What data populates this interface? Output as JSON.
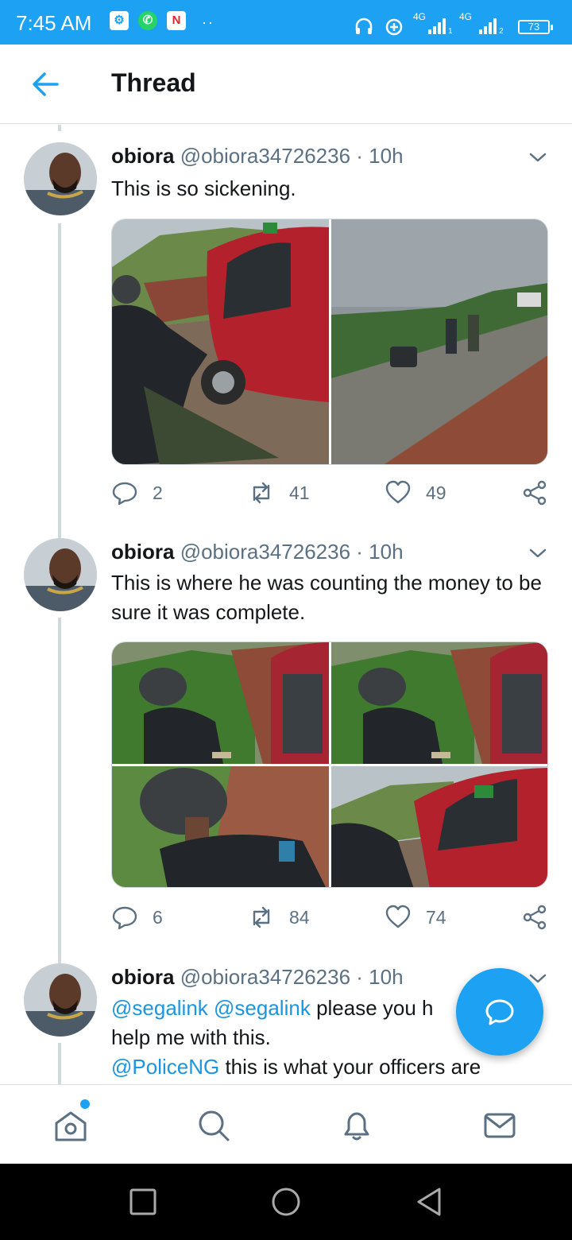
{
  "status_bar": {
    "time": "7:45 AM",
    "app_icons": [
      "settings-icon",
      "whatsapp-icon",
      "news-icon"
    ],
    "dots": "··",
    "network_1": "4G",
    "network_2": "4G",
    "sim_1": "1",
    "sim_2": "2",
    "battery": "73"
  },
  "header": {
    "back_icon": "arrow-left-icon",
    "title": "Thread"
  },
  "tweets": [
    {
      "name": "obiora",
      "handle": "@obiora34726236",
      "time": "· 10h",
      "text": "This is so sickening.",
      "replies": "2",
      "retweets": "41",
      "likes": "49"
    },
    {
      "name": "obiora",
      "handle": "@obiora34726236",
      "time": "· 10h",
      "text": "This is where he was counting the money to be sure it was complete.",
      "replies": "6",
      "retweets": "84",
      "likes": "74"
    },
    {
      "name": "obiora",
      "handle": "@obiora34726236",
      "time": "· 10h",
      "mention_1": "@segalink",
      "mention_2": "@segalink",
      "text_1": "please you h",
      "text_2": "help me with this.",
      "mention_3": "@PoliceNG",
      "text_3": "this is what your officers are"
    }
  ],
  "fab": {
    "icon": "compose-reply-icon"
  },
  "bottom_nav": {
    "items": [
      "home-icon",
      "search-icon",
      "notifications-icon",
      "messages-icon"
    ]
  },
  "system_nav": {
    "items": [
      "recents-square-icon",
      "home-circle-icon",
      "back-triangle-icon"
    ]
  },
  "colors": {
    "accent": "#1da1f2",
    "link": "#1b95e0",
    "muted": "#5b7083"
  }
}
